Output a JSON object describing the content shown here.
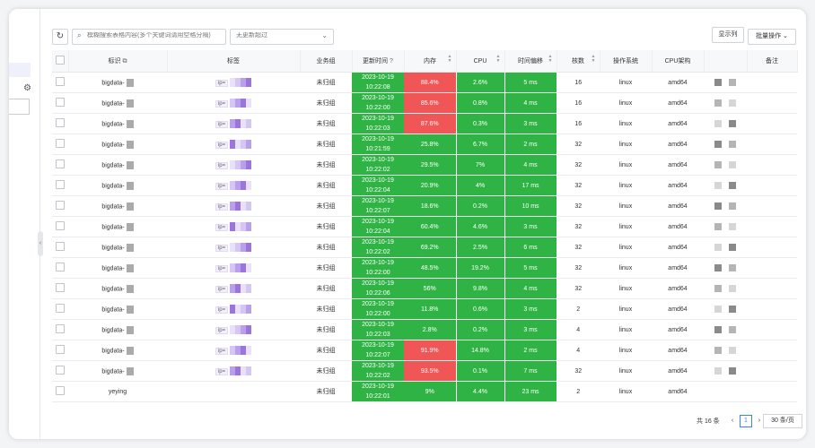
{
  "toolbar": {
    "search_placeholder": "模糊搜索表格内容(多个关键词请用空格分隔)",
    "select_placeholder": "无更新超过",
    "display_label": "显示列",
    "batch_label": "批量操作"
  },
  "columns": [
    "标识",
    "标签",
    "业务组",
    "更新时间",
    "内存",
    "CPU",
    "时间偏移",
    "核数",
    "操作系统",
    "CPU架构",
    "",
    "备注"
  ],
  "tag_prefix": "ip=",
  "rows": [
    {
      "id": "bigdata-",
      "group": "未归组",
      "date": "2023-10-19",
      "time": "10:22:08",
      "mem": "88.4%",
      "mem_alert": true,
      "cpu": "2.6%",
      "offset": "5 ms",
      "cores": "16",
      "os": "linux",
      "arch": "amd64",
      "has_tag": true
    },
    {
      "id": "bigdata-",
      "group": "未归组",
      "date": "2023-10-19",
      "time": "10:22:00",
      "mem": "85.6%",
      "mem_alert": true,
      "cpu": "0.8%",
      "offset": "4 ms",
      "cores": "16",
      "os": "linux",
      "arch": "amd64",
      "has_tag": true
    },
    {
      "id": "bigdata-",
      "group": "未归组",
      "date": "2023-10-19",
      "time": "10:22:03",
      "mem": "87.6%",
      "mem_alert": true,
      "cpu": "0.3%",
      "offset": "3 ms",
      "cores": "16",
      "os": "linux",
      "arch": "amd64",
      "has_tag": true
    },
    {
      "id": "bigdata-",
      "group": "未归组",
      "date": "2023-10-19",
      "time": "10:21:59",
      "mem": "25.8%",
      "mem_alert": false,
      "cpu": "6.7%",
      "offset": "2 ms",
      "cores": "32",
      "os": "linux",
      "arch": "amd64",
      "has_tag": true
    },
    {
      "id": "bigdata-",
      "group": "未归组",
      "date": "2023-10-19",
      "time": "10:22:02",
      "mem": "29.5%",
      "mem_alert": false,
      "cpu": "7%",
      "offset": "4 ms",
      "cores": "32",
      "os": "linux",
      "arch": "amd64",
      "has_tag": true
    },
    {
      "id": "bigdata-",
      "group": "未归组",
      "date": "2023-10-19",
      "time": "10:22:04",
      "mem": "20.9%",
      "mem_alert": false,
      "cpu": "4%",
      "offset": "17 ms",
      "cores": "32",
      "os": "linux",
      "arch": "amd64",
      "has_tag": true
    },
    {
      "id": "bigdata-",
      "group": "未归组",
      "date": "2023-10-19",
      "time": "10:22:07",
      "mem": "18.6%",
      "mem_alert": false,
      "cpu": "0.2%",
      "offset": "10 ms",
      "cores": "32",
      "os": "linux",
      "arch": "amd64",
      "has_tag": true
    },
    {
      "id": "bigdata-",
      "group": "未归组",
      "date": "2023-10-19",
      "time": "10:22:04",
      "mem": "60.4%",
      "mem_alert": false,
      "cpu": "4.6%",
      "offset": "3 ms",
      "cores": "32",
      "os": "linux",
      "arch": "amd64",
      "has_tag": true
    },
    {
      "id": "bigdata-",
      "group": "未归组",
      "date": "2023-10-19",
      "time": "10:22:02",
      "mem": "69.2%",
      "mem_alert": false,
      "cpu": "2.5%",
      "offset": "6 ms",
      "cores": "32",
      "os": "linux",
      "arch": "amd64",
      "has_tag": true
    },
    {
      "id": "bigdata-",
      "group": "未归组",
      "date": "2023-10-19",
      "time": "10:22:00",
      "mem": "48.5%",
      "mem_alert": false,
      "cpu": "19.2%",
      "offset": "5 ms",
      "cores": "32",
      "os": "linux",
      "arch": "amd64",
      "has_tag": true
    },
    {
      "id": "bigdata-",
      "group": "未归组",
      "date": "2023-10-19",
      "time": "10:22:06",
      "mem": "56%",
      "mem_alert": false,
      "cpu": "9.8%",
      "offset": "4 ms",
      "cores": "32",
      "os": "linux",
      "arch": "amd64",
      "has_tag": true
    },
    {
      "id": "bigdata-",
      "group": "未归组",
      "date": "2023-10-19",
      "time": "10:22:00",
      "mem": "11.8%",
      "mem_alert": false,
      "cpu": "0.6%",
      "offset": "3 ms",
      "cores": "2",
      "os": "linux",
      "arch": "amd64",
      "has_tag": true
    },
    {
      "id": "bigdata-",
      "group": "未归组",
      "date": "2023-10-19",
      "time": "10:22:03",
      "mem": "2.8%",
      "mem_alert": false,
      "cpu": "0.2%",
      "offset": "3 ms",
      "cores": "4",
      "os": "linux",
      "arch": "amd64",
      "has_tag": true
    },
    {
      "id": "bigdata-",
      "group": "未归组",
      "date": "2023-10-19",
      "time": "10:22:07",
      "mem": "91.9%",
      "mem_alert": true,
      "cpu": "14.8%",
      "offset": "2 ms",
      "cores": "4",
      "os": "linux",
      "arch": "amd64",
      "has_tag": true
    },
    {
      "id": "bigdata-",
      "group": "未归组",
      "date": "2023-10-19",
      "time": "10:22:02",
      "mem": "93.5%",
      "mem_alert": true,
      "cpu": "0.1%",
      "offset": "7 ms",
      "cores": "32",
      "os": "linux",
      "arch": "amd64",
      "has_tag": true
    },
    {
      "id": "yeying",
      "group": "未归组",
      "date": "2023-10-19",
      "time": "10:22:01",
      "mem": "9%",
      "mem_alert": false,
      "cpu": "4.4%",
      "offset": "23 ms",
      "cores": "2",
      "os": "linux",
      "arch": "amd64",
      "has_tag": false
    }
  ],
  "colors": {
    "ok": "#2fb344",
    "alert": "#f05656",
    "accent": "#3b82f6"
  },
  "footer": {
    "total": "共 16 条",
    "page": "1",
    "page_size": "30 条/页",
    "prev": "‹",
    "next": "›"
  }
}
